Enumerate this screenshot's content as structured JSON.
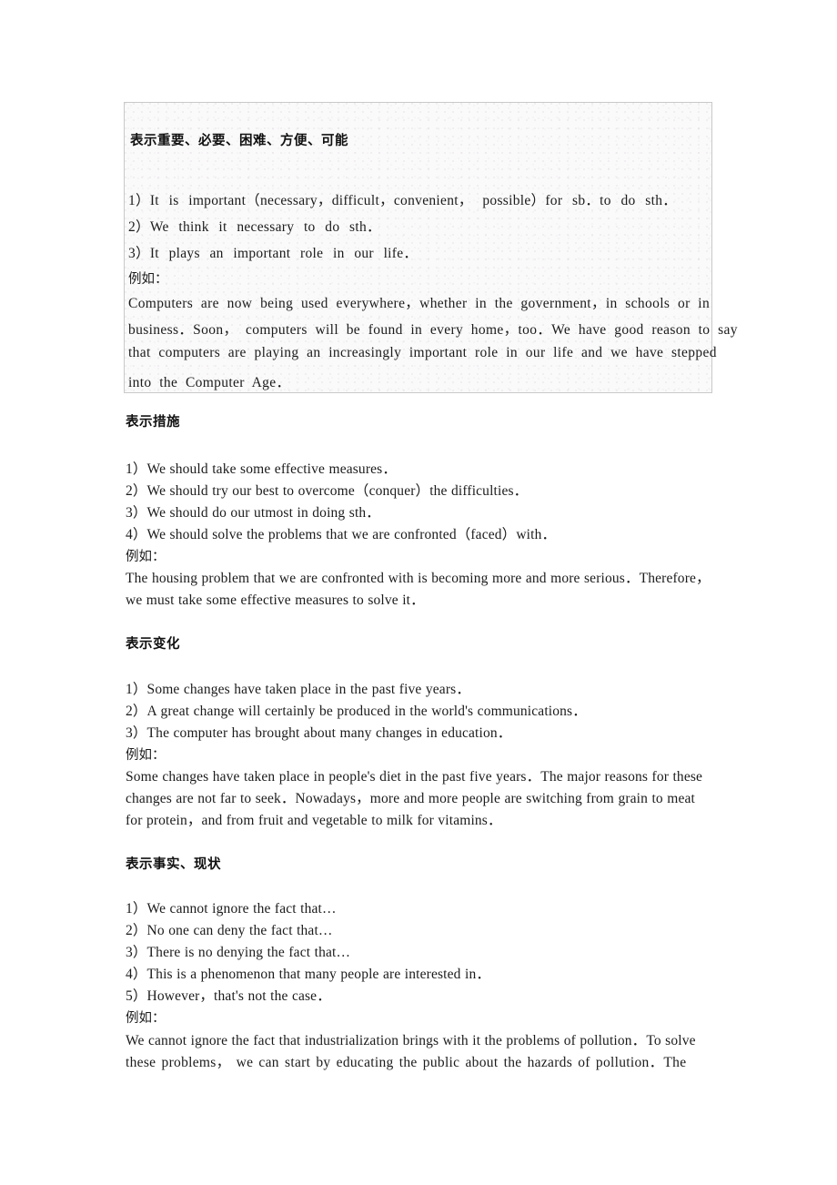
{
  "document": {
    "type": "chinese-english-writing-templates",
    "page_background": "#ffffff",
    "text_color": "#1b1b1b",
    "box_border_color": "#c9c9c9",
    "box_background": "#fafafa"
  },
  "sections": [
    {
      "id": "importance",
      "heading": "表示重要、必要、困难、方便、可能",
      "shaded": true,
      "items": [
        "1）It is important（necessary，difficult，convenient，  possible）for sb．to do sth．",
        "2）We think it necessary to do sth．",
        "3）It plays an important role in our life．"
      ],
      "example_label": "例如：",
      "example_lines": [
        "Computers are now being used everywhere，whether in the government，in schools or in",
        "business．Soon，  computers will be found in every home，too．We have good reason to say",
        "that computers are playing an increasingly important role in our life and we have stepped",
        "into the Computer Age．"
      ]
    },
    {
      "id": "measures",
      "heading": "表示措施",
      "shaded": false,
      "items": [
        "1）We should take some effective measures．",
        "2）We should try our best to overcome（conquer）the difficulties．",
        "3）We should do our utmost in doing sth．",
        "4）We should solve the problems that we are confronted（faced）with．"
      ],
      "example_label": "例如：",
      "example_lines": [
        "The housing problem that we are confronted with is becoming more and more serious．Therefore，",
        "we must take some effective measures to solve it．"
      ]
    },
    {
      "id": "changes",
      "heading": "表示变化",
      "shaded": false,
      "items": [
        "1）Some changes have taken place in the past five years．",
        "2）A great change will certainly be produced in the world's communications．",
        "3）The computer has brought about many changes in education．"
      ],
      "example_label": "例如：",
      "example_lines": [
        "Some changes have taken place in people's diet in the past five years．The major reasons for these",
        "changes are not far to seek．Nowadays，more and more people are switching from grain to meat",
        "for protein，and from fruit and vegetable to milk for vitamins．"
      ]
    },
    {
      "id": "facts",
      "heading": "表示事实、现状",
      "shaded": false,
      "items": [
        "1）We cannot ignore the fact that…",
        "2）No one can deny the fact that…",
        "3）There is no denying the fact that…",
        "4）This is a phenomenon that many people are interested in．",
        "5）However，that's not the case．"
      ],
      "example_label": "例如：",
      "example_lines": [
        "We cannot ignore the fact that industrialization brings with it the problems of pollution．To solve",
        "these problems，  we can start by educating the public about the hazards of pollution．The"
      ]
    }
  ]
}
